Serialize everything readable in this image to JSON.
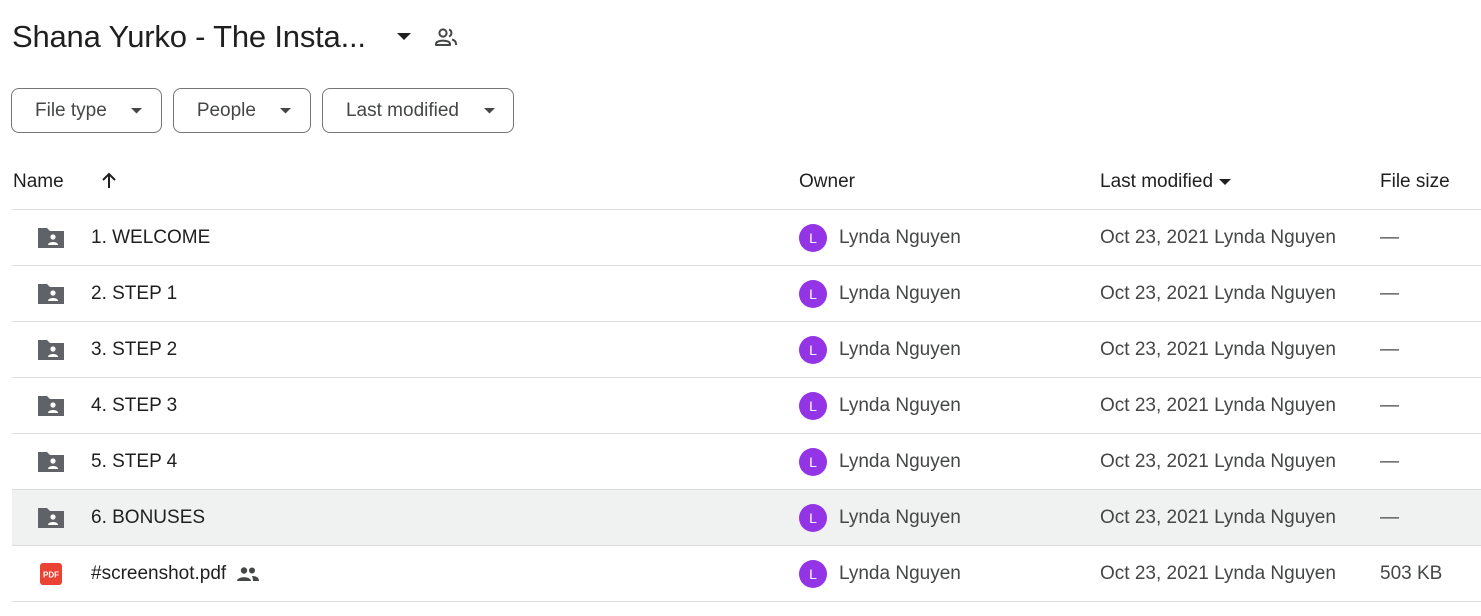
{
  "header": {
    "title": "Shana Yurko - The Insta...",
    "title_caret_icon": "caret-down-icon",
    "shared_icon": "people-outline-icon"
  },
  "filters": [
    {
      "label": "File type",
      "icon": "caret-down-icon"
    },
    {
      "label": "People",
      "icon": "caret-down-icon"
    },
    {
      "label": "Last modified",
      "icon": "caret-down-icon"
    }
  ],
  "table": {
    "columns": {
      "name": "Name",
      "owner": "Owner",
      "last_modified": "Last modified",
      "file_size": "File size"
    },
    "rows": [
      {
        "name": "1. WELCOME",
        "type": "shared-folder",
        "owner_initial": "L",
        "owner": "Lynda Nguyen",
        "modified": "Oct 23, 2021 Lynda Nguyen",
        "size": "—"
      },
      {
        "name": "2. STEP 1",
        "type": "shared-folder",
        "owner_initial": "L",
        "owner": "Lynda Nguyen",
        "modified": "Oct 23, 2021 Lynda Nguyen",
        "size": "—"
      },
      {
        "name": "3. STEP 2",
        "type": "shared-folder",
        "owner_initial": "L",
        "owner": "Lynda Nguyen",
        "modified": "Oct 23, 2021 Lynda Nguyen",
        "size": "—"
      },
      {
        "name": "4. STEP 3",
        "type": "shared-folder",
        "owner_initial": "L",
        "owner": "Lynda Nguyen",
        "modified": "Oct 23, 2021 Lynda Nguyen",
        "size": "—"
      },
      {
        "name": "5. STEP 4",
        "type": "shared-folder",
        "owner_initial": "L",
        "owner": "Lynda Nguyen",
        "modified": "Oct 23, 2021 Lynda Nguyen",
        "size": "—"
      },
      {
        "name": "6. BONUSES",
        "type": "shared-folder",
        "owner_initial": "L",
        "owner": "Lynda Nguyen",
        "modified": "Oct 23, 2021 Lynda Nguyen",
        "size": "—"
      },
      {
        "name": "#screenshot.pdf",
        "type": "pdf",
        "pdf_label": "PDF",
        "shared": true,
        "owner_initial": "L",
        "owner": "Lynda Nguyen",
        "modified": "Oct 23, 2021 Lynda Nguyen",
        "size": "503 KB"
      }
    ]
  },
  "colors": {
    "avatar": "#9334e6",
    "pdf_red": "#ea4335",
    "folder_gray": "#5f6368",
    "hover_row": "#f0f1f1",
    "divider": "#dadce0"
  }
}
